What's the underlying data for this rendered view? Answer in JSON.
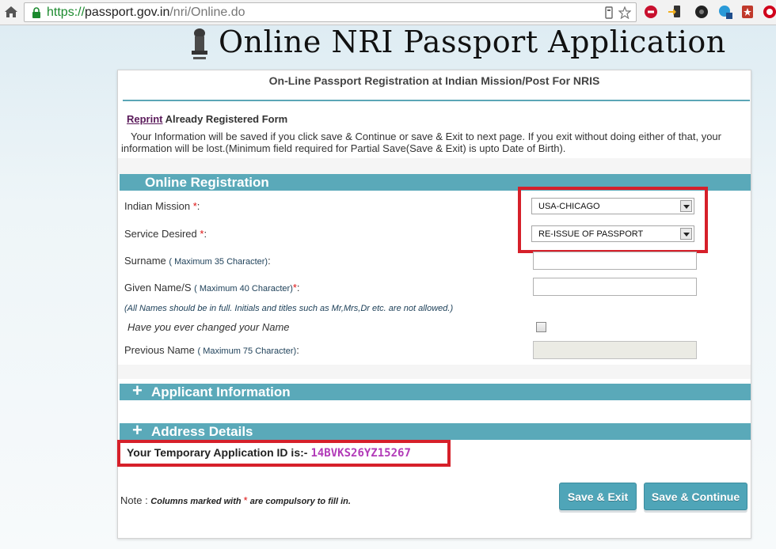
{
  "browser": {
    "url_scheme": "https://",
    "url_host": "passport.gov.in",
    "url_path": "/nri/Online.do"
  },
  "banner": {
    "title": "Online NRI Passport Application",
    "emblem_icon": "national-emblem-icon"
  },
  "panel": {
    "subtitle": "On-Line Passport Registration at Indian Mission/Post For NRIS",
    "reprint_link": "Reprint",
    "reprint_suffix": " Already Registered Form",
    "info_text": "Your Information will be saved if you click save & Continue or save & Exit to next page. If you exit without  doing either of that, your information will be lost.(Minimum field required for Partial Save(Save & Exit) is upto  Date of Birth)."
  },
  "online_registration": {
    "title": "Online Registration",
    "indian_mission_label": "Indian Mission ",
    "indian_mission_value": "USA-CHICAGO",
    "service_desired_label": "Service Desired ",
    "service_desired_value": "RE-ISSUE OF PASSPORT",
    "surname_label": "Surname ",
    "surname_hint": "( Maximum 35 Character)",
    "given_name_label": "Given Name/S ",
    "given_name_hint": "( Maximum 40 Character)",
    "names_note": "(All Names should be in full. Initials and titles such as Mr,Mrs,Dr etc. are not allowed.)",
    "changed_name_label": "Have you ever changed your Name",
    "previous_name_label": "Previous Name ",
    "previous_name_hint": "( Maximum 75 Character)",
    "required_mark": "*",
    "colon": ":"
  },
  "sections": {
    "applicant_information": "Applicant Information",
    "address_details": "Address Details",
    "expand_symbol": "+"
  },
  "temporary_id": {
    "label": "Your Temporary Application ID is:-",
    "value": "14BVKS26YZ15267"
  },
  "footer": {
    "note_label": "Note : ",
    "note_text_before": "Columns marked with ",
    "note_star": "*",
    "note_text_after": " are compulsory to fill in.",
    "save_exit": "Save & Exit",
    "save_continue": "Save & Continue"
  },
  "colors": {
    "section_bar": "#5aa9b9",
    "highlight_box": "#d6202a",
    "temp_id": "#b23bb8",
    "required": "#dd1111"
  }
}
